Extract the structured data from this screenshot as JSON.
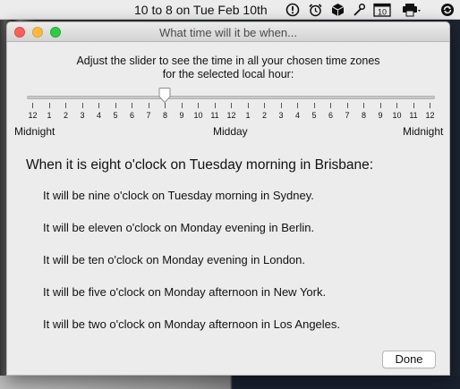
{
  "menubar": {
    "clock": "10 to 8 on Tue Feb 10th",
    "icons": [
      "info-icon",
      "alarm-clock-icon",
      "cube-icon",
      "wrench-icon",
      "calendar-icon",
      "printer-icon",
      "sync-icon"
    ],
    "calendar_day": "10"
  },
  "window": {
    "title": "What time will it be when...",
    "instructions_line1": "Adjust the slider to see the time in all your chosen time zones",
    "instructions_line2": "for the selected local hour:",
    "slider": {
      "value_hour": 8,
      "min": 0,
      "max": 24,
      "tick_labels": [
        "12",
        "1",
        "2",
        "3",
        "4",
        "5",
        "6",
        "7",
        "8",
        "9",
        "10",
        "11",
        "12",
        "1",
        "2",
        "3",
        "4",
        "5",
        "6",
        "7",
        "8",
        "9",
        "10",
        "11",
        "12"
      ],
      "left_label": "Midnight",
      "middle_label": "Midday",
      "right_label": "Midnight"
    },
    "headline": "When it is eight o'clock on Tuesday morning in Brisbane:",
    "results": [
      "It will be nine o'clock on Tuesday morning in Sydney.",
      "It will be eleven o'clock on Monday evening in Berlin.",
      "It will be ten o'clock on Monday evening in London.",
      "It will be five o'clock on Monday afternoon in New York.",
      "It will be two o'clock on Monday afternoon in Los Angeles."
    ],
    "done_label": "Done"
  },
  "colors": {
    "close": "#fc605b",
    "minimize": "#fdbc40",
    "maximize": "#34c84a",
    "window_bg": "#ececec"
  }
}
